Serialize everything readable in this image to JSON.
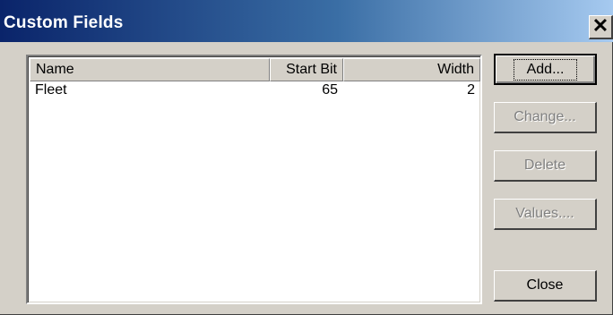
{
  "window": {
    "title": "Custom Fields",
    "close_glyph": "✕"
  },
  "list": {
    "columns": [
      "Name",
      "Start Bit",
      "Width"
    ],
    "rows": [
      {
        "name": "Fleet",
        "start_bit": "65",
        "width": "2"
      }
    ]
  },
  "buttons": {
    "add": "Add...",
    "change": "Change...",
    "delete": "Delete",
    "values": "Values....",
    "close": "Close"
  }
}
